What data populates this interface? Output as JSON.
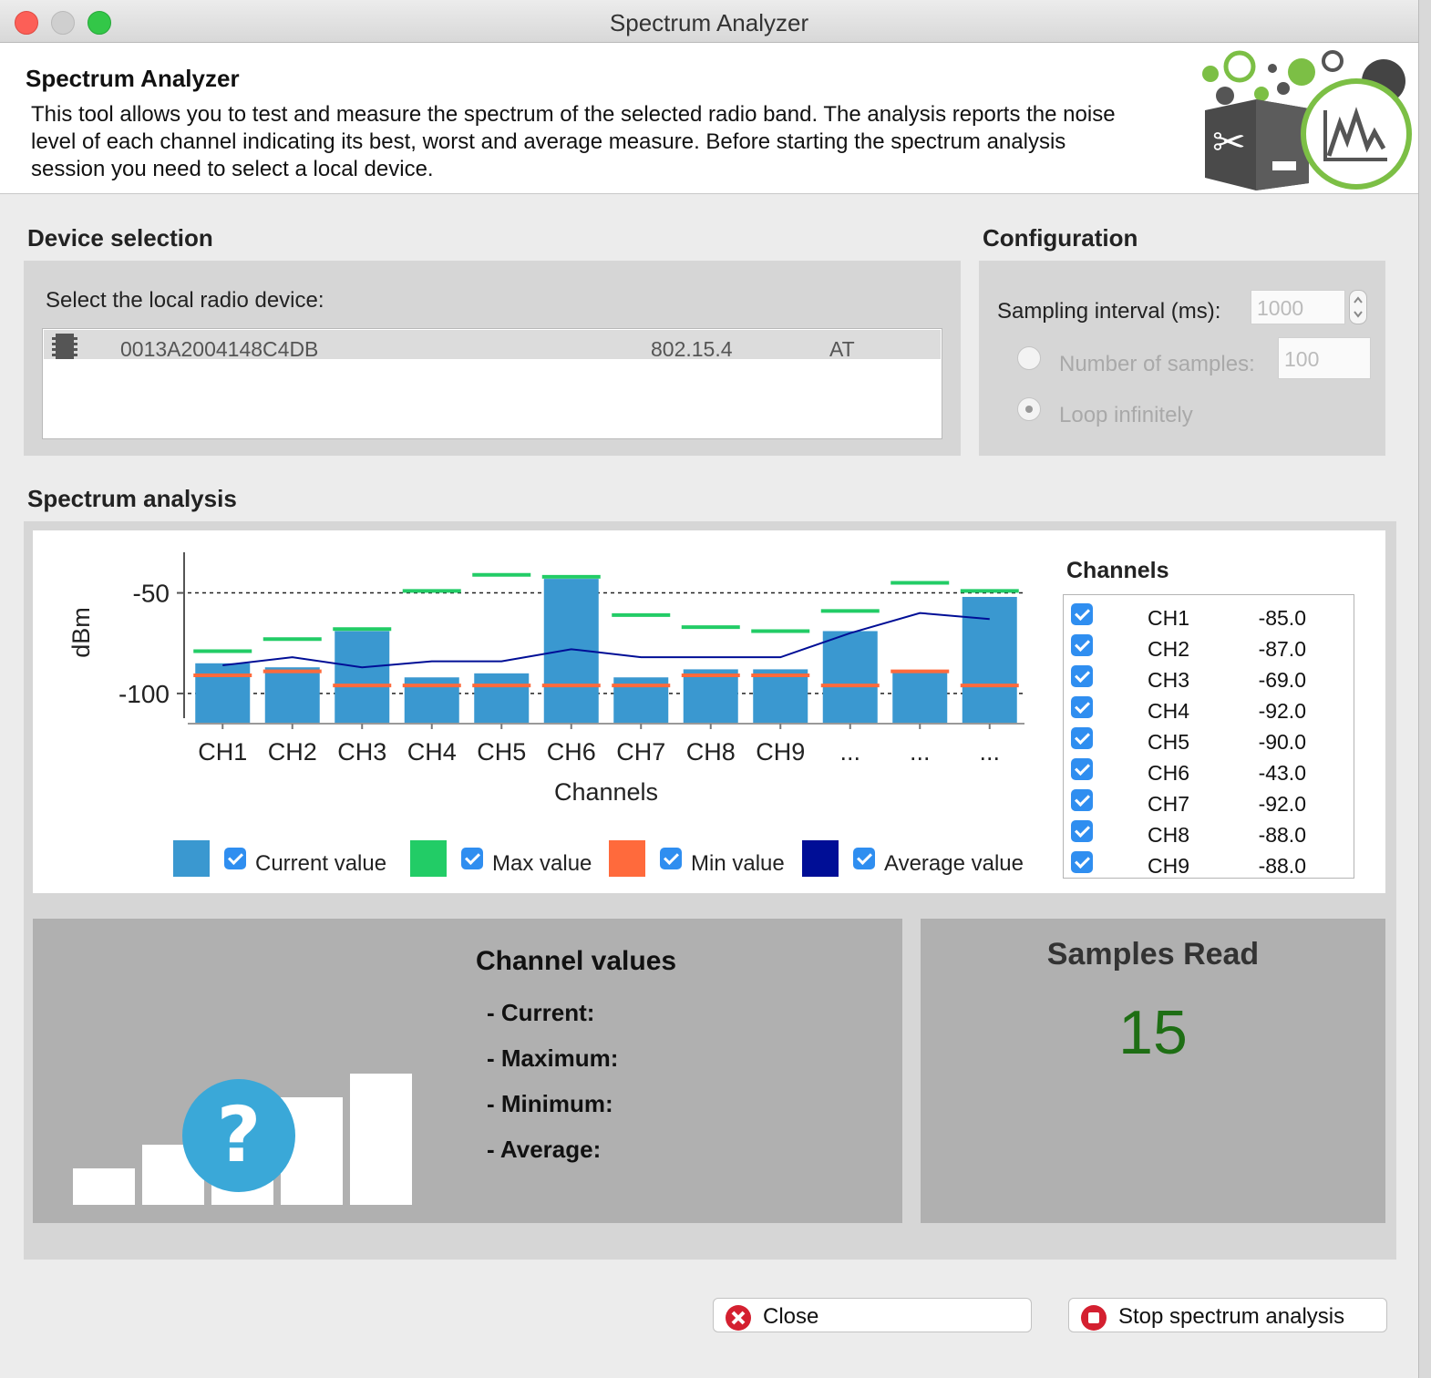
{
  "window": {
    "title": "Spectrum Analyzer"
  },
  "header": {
    "title": "Spectrum Analyzer",
    "description": "This tool allows you to test and measure the spectrum of the selected radio band. The analysis reports the noise level of each channel indicating its best, worst and average measure. Before starting the spectrum analysis session you need to select a local device."
  },
  "device_selection": {
    "title": "Device selection",
    "prompt": "Select the local radio device:",
    "devices": [
      {
        "mac": "0013A2004148C4DB",
        "protocol": "802.15.4",
        "mode": "AT"
      }
    ]
  },
  "configuration": {
    "title": "Configuration",
    "sampling_label": "Sampling interval (ms):",
    "sampling_value": "1000",
    "samples_label": "Number of samples:",
    "samples_value": "100",
    "loop_label": "Loop infinitely",
    "loop_selected": true
  },
  "spectrum": {
    "title": "Spectrum analysis",
    "legend": {
      "current": "Current value",
      "max": "Max value",
      "min": "Min value",
      "average": "Average value"
    },
    "channels_title": "Channels",
    "channels": [
      {
        "name": "CH1",
        "value": "-85.0"
      },
      {
        "name": "CH2",
        "value": "-87.0"
      },
      {
        "name": "CH3",
        "value": "-69.0"
      },
      {
        "name": "CH4",
        "value": "-92.0"
      },
      {
        "name": "CH5",
        "value": "-90.0"
      },
      {
        "name": "CH6",
        "value": "-43.0"
      },
      {
        "name": "CH7",
        "value": "-92.0"
      },
      {
        "name": "CH8",
        "value": "-88.0"
      },
      {
        "name": "CH9",
        "value": "-88.0"
      }
    ]
  },
  "chart_data": {
    "type": "bar",
    "categories": [
      "CH1",
      "CH2",
      "CH3",
      "CH4",
      "CH5",
      "CH6",
      "CH7",
      "CH8",
      "CH9",
      "...",
      "...",
      "..."
    ],
    "xlabel": "Channels",
    "ylabel": "dBm",
    "yticks": [
      -50,
      -100
    ],
    "ylim": [
      -115,
      -28
    ],
    "reference_lines": [
      -50,
      -100
    ],
    "series": [
      {
        "name": "Current value",
        "kind": "bar",
        "color": "#3a98d0",
        "values": [
          -85,
          -87,
          -69,
          -92,
          -90,
          -43,
          -92,
          -88,
          -88,
          -69,
          -89,
          -52
        ]
      },
      {
        "name": "Max value",
        "kind": "marker",
        "color": "#22cc66",
        "values": [
          -79,
          -73,
          -68,
          -49,
          -41,
          -42,
          -61,
          -67,
          -69,
          -59,
          -45,
          -49
        ]
      },
      {
        "name": "Min value",
        "kind": "marker",
        "color": "#ff6a3c",
        "values": [
          -91,
          -89,
          -96,
          -96,
          -96,
          -96,
          -96,
          -91,
          -91,
          -96,
          -89,
          -96
        ]
      },
      {
        "name": "Average value",
        "kind": "line",
        "color": "#000e96",
        "values": [
          -86,
          -82,
          -87,
          -84,
          -84,
          -78,
          -82,
          -82,
          -82,
          -70,
          -60,
          -63
        ]
      }
    ]
  },
  "channel_values": {
    "title": "Channel values",
    "current": "- Current:",
    "maximum": "- Maximum:",
    "minimum": "- Minimum:",
    "average": "- Average:"
  },
  "samples": {
    "title": "Samples Read",
    "value": "15"
  },
  "buttons": {
    "close": "Close",
    "stop": "Stop spectrum analysis"
  },
  "colors": {
    "accent": "#2f8ef0",
    "samples_value": "#1e6e14"
  }
}
